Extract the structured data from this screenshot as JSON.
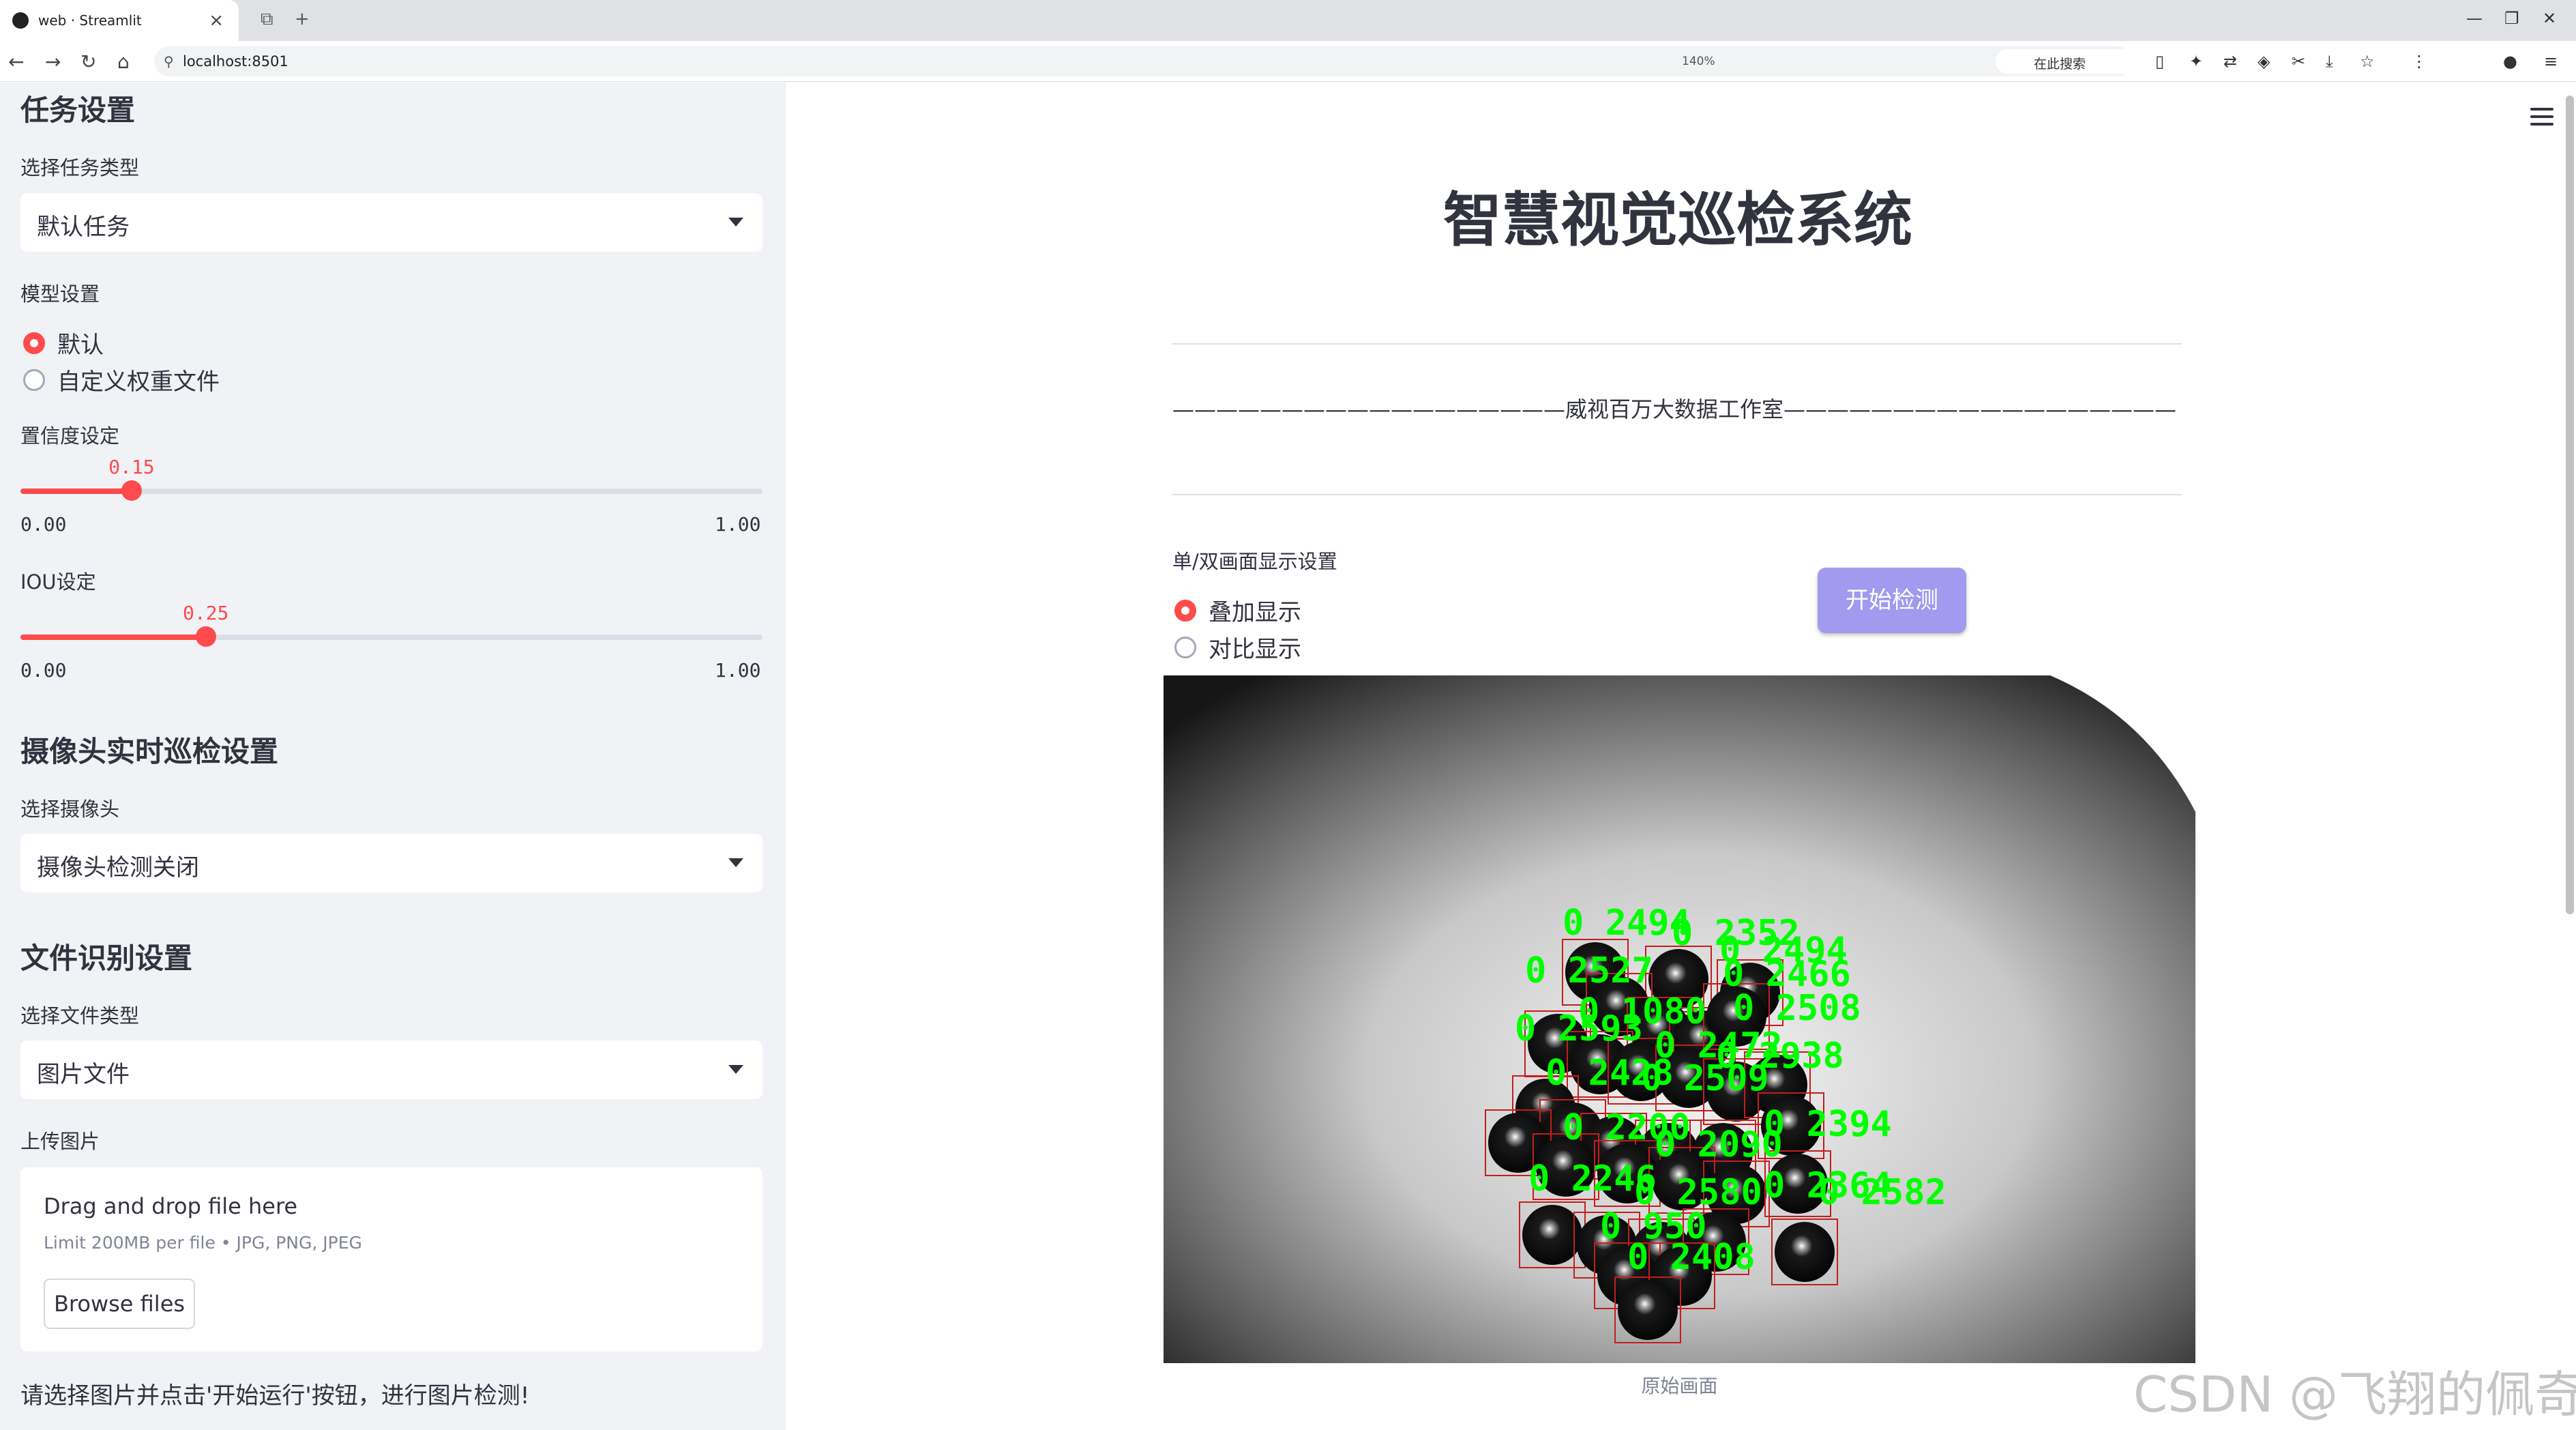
{
  "browser": {
    "tab_title": "web · Streamlit",
    "url": "localhost:8501",
    "zoom": "140%",
    "search_placeholder": "在此搜索"
  },
  "sidebar": {
    "task_heading": "任务设置",
    "task_type_label": "选择任务类型",
    "task_type_value": "默认任务",
    "model_label": "模型设置",
    "model_options": [
      "默认",
      "自定义权重文件"
    ],
    "model_selected": "默认",
    "conf_label": "置信度设定",
    "conf": {
      "value": 0.15,
      "value_text": "0.15",
      "min": "0.00",
      "max": "1.00"
    },
    "iou_label": "IOU设定",
    "iou": {
      "value": 0.25,
      "value_text": "0.25",
      "min": "0.00",
      "max": "1.00"
    },
    "camera_heading": "摄像头实时巡检设置",
    "camera_label": "选择摄像头",
    "camera_value": "摄像头检测关闭",
    "file_heading": "文件识别设置",
    "file_type_label": "选择文件类型",
    "file_type_value": "图片文件",
    "upload_label": "上传图片",
    "upload_drag": "Drag and drop file here",
    "upload_limit": "Limit 200MB per file • JPG, PNG, JPEG",
    "browse_button": "Browse files",
    "hint": "请选择图片并点击'开始运行'按钮，进行图片检测!"
  },
  "main": {
    "title": "智慧视觉巡检系统",
    "studio_line": "——————————————————威视百万大数据工作室——————————————————",
    "display_mode_label": "单/双画面显示设置",
    "display_options": [
      "叠加显示",
      "对比显示"
    ],
    "display_selected": "叠加显示",
    "start_button": "开始检测",
    "image_caption": "原始画面",
    "detections": [
      "0 2494",
      "0 2352",
      "0 2494",
      "0 2527",
      "0 2466",
      "0 2508",
      "0 2593",
      "0 1080",
      "0 2472",
      "0 2938",
      "0 2428",
      "0 2509",
      "0 2394",
      "0 2200",
      "0 2090",
      "0 2246",
      "0 2580",
      "0 2364",
      "0 2582",
      "0 950",
      "0 2408"
    ]
  },
  "watermark": "CSDN @飞翔的佩奇",
  "colors": {
    "accent": "#ff4b4b",
    "button": "#a09bef",
    "detect_label": "#00ff00",
    "detect_box": "#c41e1e"
  }
}
